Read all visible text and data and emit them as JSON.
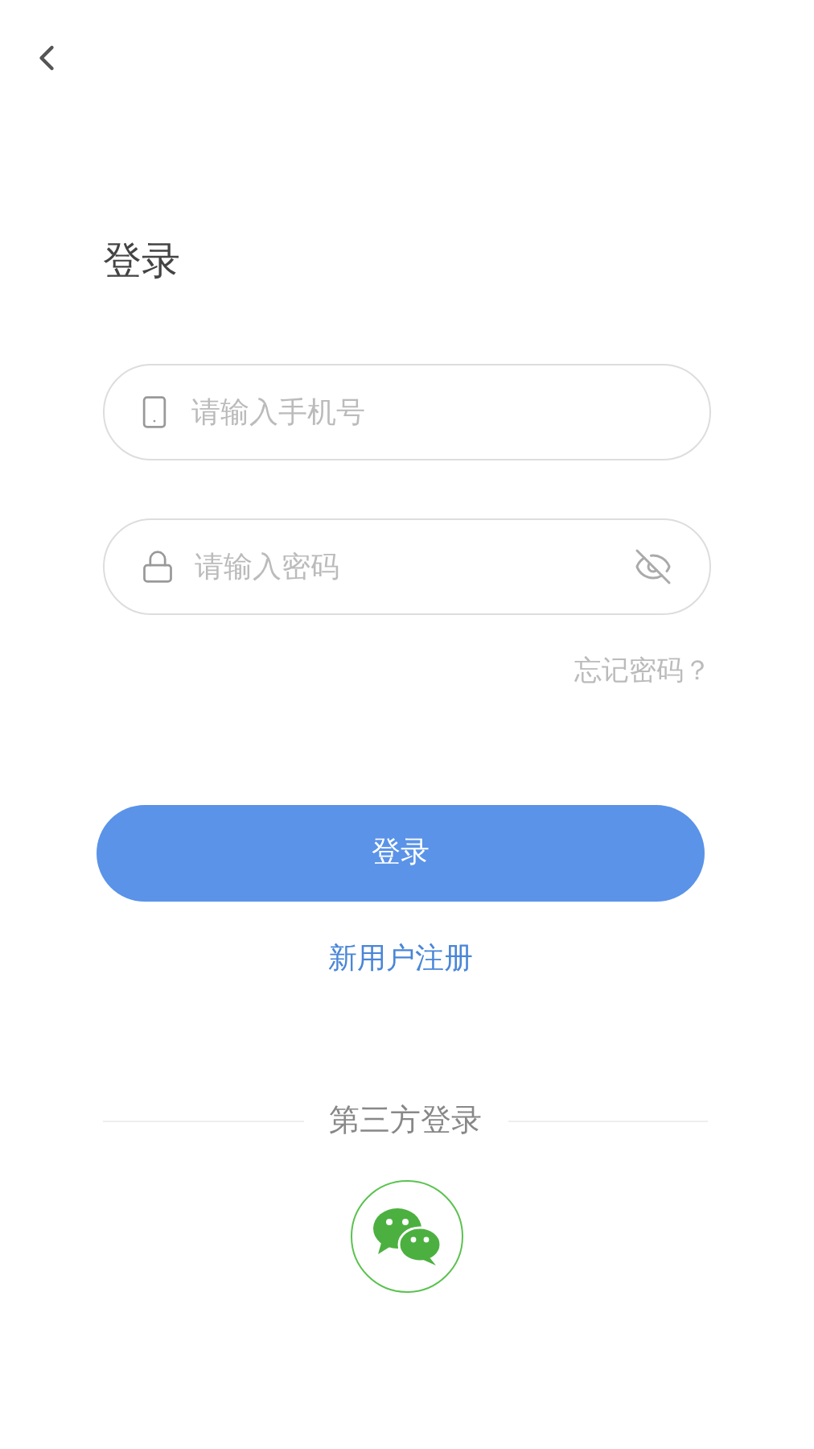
{
  "title": "登录",
  "phone_field": {
    "placeholder": "请输入手机号"
  },
  "password_field": {
    "placeholder": "请输入密码",
    "visible": false
  },
  "forgot_link": "忘记密码？",
  "login_button": "登录",
  "register_link": "新用户注册",
  "third_party": {
    "label": "第三方登录"
  }
}
